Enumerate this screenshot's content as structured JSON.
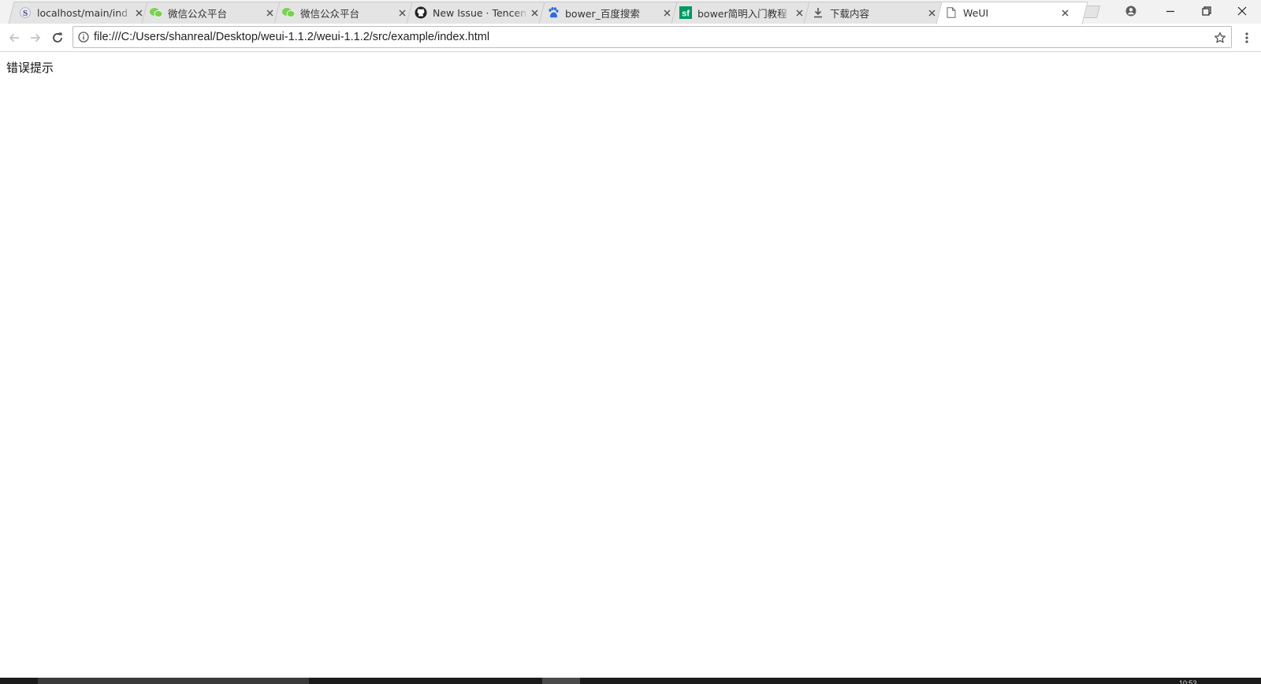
{
  "tabs": [
    {
      "title": "localhost/main/ind",
      "icon": "s-favicon-icon"
    },
    {
      "title": "微信公众平台",
      "icon": "wechat-icon"
    },
    {
      "title": "微信公众平台",
      "icon": "wechat-icon"
    },
    {
      "title": "New Issue · Tencen",
      "icon": "github-icon"
    },
    {
      "title": "bower_百度搜索",
      "icon": "baidu-paw-icon"
    },
    {
      "title": "bower简明入门教程",
      "icon": "segmentfault-icon"
    },
    {
      "title": "下载内容",
      "icon": "download-icon"
    },
    {
      "title": "WeUI",
      "icon": "document-icon",
      "active": true
    }
  ],
  "address_bar": {
    "url": "file:///C:/Users/shanreal/Desktop/weui-1.1.2/weui-1.1.2/src/example/index.html"
  },
  "page": {
    "text": "错误提示"
  },
  "taskbar": {
    "clock": "10:53"
  },
  "colors": {
    "tab_strip_bg": "#f2f2f2",
    "inactive_tab_bg": "#e4e4e4",
    "active_tab_bg": "#ffffff",
    "wechat_green": "#7bd14f",
    "sf_green": "#009a61",
    "baidu_blue": "#2d6cdf",
    "taskbar_bg": "#1b1b1b"
  }
}
